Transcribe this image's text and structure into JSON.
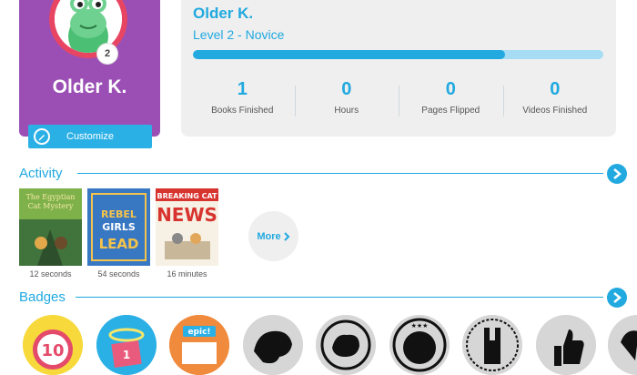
{
  "profile": {
    "name": "Older K.",
    "level_number": "2",
    "customize_label": "Customize"
  },
  "stats": {
    "name": "Older K.",
    "level": "Level 2 - Novice",
    "progress_fraction": 0.76,
    "items": [
      {
        "value": "1",
        "label": "Books Finished"
      },
      {
        "value": "0",
        "label": "Hours"
      },
      {
        "value": "0",
        "label": "Pages Flipped"
      },
      {
        "value": "0",
        "label": "Videos Finished"
      }
    ]
  },
  "activity": {
    "title": "Activity",
    "books": [
      {
        "cover_title": "The Egyptian Cat Mystery",
        "time": "12 seconds"
      },
      {
        "cover_title": "REBEL GIRLS LEAD",
        "time": "54 seconds"
      },
      {
        "cover_title": "BREAKING CAT NEWS",
        "time": "16 minutes"
      }
    ],
    "more_label": "More"
  },
  "badges": {
    "title": "Badges",
    "first_badge_number": "10",
    "second_badge_number": "1",
    "epic_badge_text": "epic!"
  },
  "colors": {
    "accent": "#21a9e0",
    "profile_bg": "#9b4fb5",
    "panel_bg": "#efefef",
    "avatar_ring": "#e84563"
  },
  "icons": [
    "pencil-icon",
    "chevron-right-icon",
    "frog-avatar-icon",
    "alarm-clock-badge-icon",
    "gift-badge-icon"
  ]
}
